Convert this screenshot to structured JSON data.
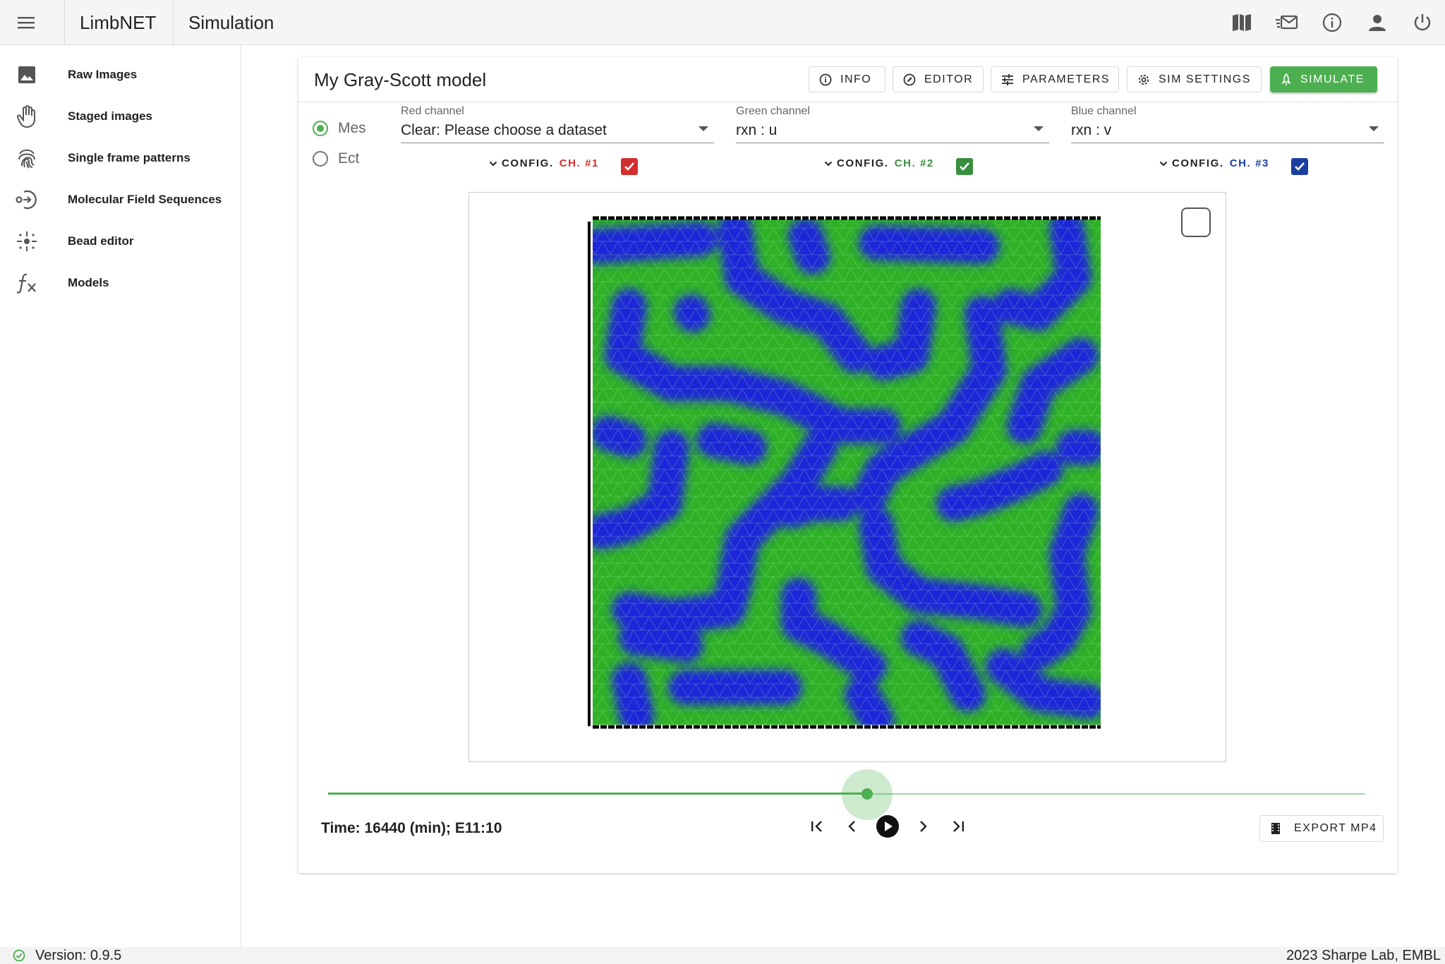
{
  "app": {
    "name": "LimbNET",
    "page_title": "Simulation"
  },
  "sidebar": {
    "items": [
      {
        "label": "Raw Images",
        "icon": "image-icon"
      },
      {
        "label": "Staged images",
        "icon": "hand-icon"
      },
      {
        "label": "Single frame patterns",
        "icon": "fingerprint-icon"
      },
      {
        "label": "Molecular Field Sequences",
        "icon": "sequence-icon"
      },
      {
        "label": "Bead editor",
        "icon": "bead-icon"
      },
      {
        "label": "Models",
        "icon": "function-icon"
      }
    ]
  },
  "model": {
    "title": "My Gray-Scott model",
    "buttons": {
      "info": "INFO",
      "editor": "EDITOR",
      "parameters": "PARAMETERS",
      "sim_settings": "SIM SETTINGS",
      "simulate": "SIMULATE"
    }
  },
  "tissue": {
    "options": [
      {
        "label": "Mes",
        "selected": true
      },
      {
        "label": "Ect",
        "selected": false
      }
    ]
  },
  "channels": [
    {
      "label": "Red channel",
      "value": "Clear: Please choose a dataset",
      "config": "CONFIG.",
      "ch": "CH. #1",
      "color": "#d32f2f",
      "enabled": true
    },
    {
      "label": "Green channel",
      "value": "rxn : u",
      "config": "CONFIG.",
      "ch": "CH. #2",
      "color": "#388e3c",
      "enabled": true
    },
    {
      "label": "Blue channel",
      "value": "rxn : v",
      "config": "CONFIG.",
      "ch": "CH. #3",
      "color": "#1a3f9e",
      "enabled": true
    }
  ],
  "viewer": {
    "overlay_checked": false
  },
  "timeline": {
    "progress": 0.52,
    "time_text": "Time: 16440 (min); E11:10"
  },
  "export": {
    "label": "EXPORT MP4"
  },
  "status": {
    "version": "Version: 0.9.5",
    "credit": "2023 Sharpe Lab, EMBL",
    "ok_color": "#4caf50"
  }
}
